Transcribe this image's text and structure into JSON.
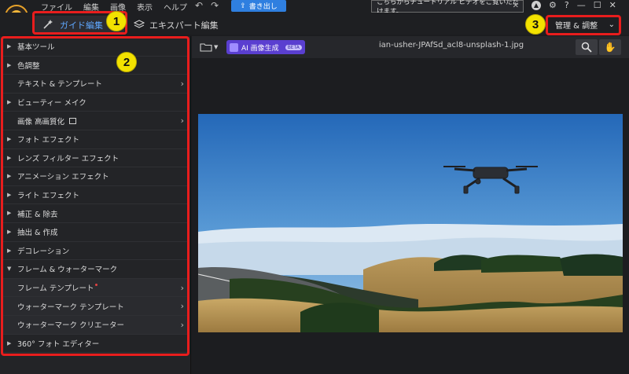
{
  "menu": {
    "items": [
      "ファイル",
      "編集",
      "画像",
      "表示",
      "ヘルプ"
    ]
  },
  "toolbar": {
    "export_label": "書き出し",
    "notice_text": "こちらからチュートリアル ビデオをご覧いただけます。",
    "help": "?"
  },
  "modes": {
    "guide_label": "ガイド編集",
    "expert_label": "エキスパート編集",
    "manage_label": "管理 & 調整"
  },
  "badges": [
    "1",
    "2",
    "3"
  ],
  "sidebar": {
    "items": [
      {
        "label": "基本ツール",
        "kind": "cat"
      },
      {
        "label": "色調整",
        "kind": "cat"
      },
      {
        "label": "テキスト & テンプレート",
        "kind": "sub"
      },
      {
        "label": "ビューティー メイク",
        "kind": "cat"
      },
      {
        "label": "画像 高画質化",
        "kind": "sub"
      },
      {
        "label": "フォト エフェクト",
        "kind": "cat"
      },
      {
        "label": "レンズ フィルター エフェクト",
        "kind": "cat"
      },
      {
        "label": "アニメーション エフェクト",
        "kind": "cat"
      },
      {
        "label": "ライト エフェクト",
        "kind": "cat"
      },
      {
        "label": "補正 & 除去",
        "kind": "cat"
      },
      {
        "label": "抽出 & 作成",
        "kind": "cat"
      },
      {
        "label": "デコレーション",
        "kind": "cat"
      },
      {
        "label": "フレーム & ウォーターマーク",
        "kind": "open"
      },
      {
        "label": "フレーム テンプレート",
        "kind": "child"
      },
      {
        "label": "ウォーターマーク テンプレート",
        "kind": "child"
      },
      {
        "label": "ウォーターマーク クリエーター",
        "kind": "child"
      },
      {
        "label": "360° フォト エディター",
        "kind": "cat"
      }
    ]
  },
  "workspace": {
    "ai_label": "AI 画像生成",
    "beta_label": "BETA",
    "filename": "ian-usher-JPAfSd_acl8-unsplash-1.jpg"
  },
  "colors": {
    "accent_blue": "#2f7fe0",
    "annotation_red": "#e81d1d",
    "badge_yellow": "#f3e200",
    "ai_purple": "#5a3fd0"
  }
}
